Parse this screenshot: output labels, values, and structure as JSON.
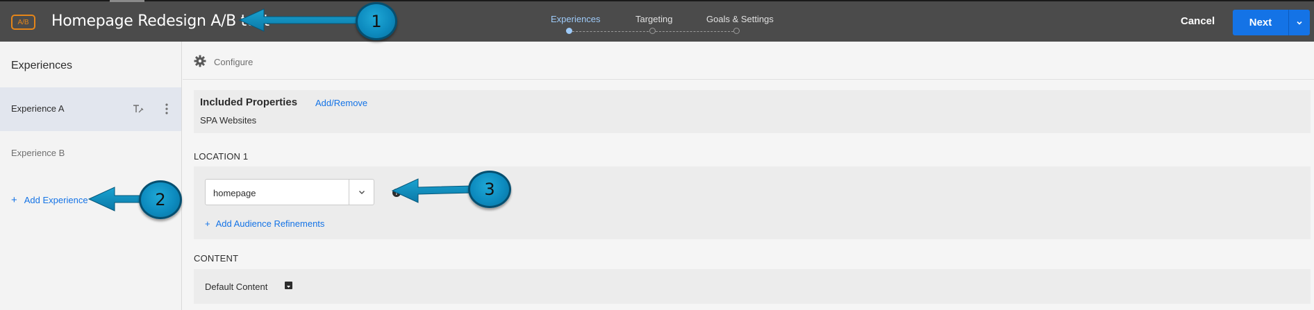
{
  "header": {
    "badge": "A/B",
    "activity_title": "Homepage Redesign A/B test",
    "steps": [
      {
        "label": "Experiences",
        "active": true
      },
      {
        "label": "Targeting",
        "active": false
      },
      {
        "label": "Goals & Settings",
        "active": false
      }
    ],
    "cancel_label": "Cancel",
    "next_label": "Next"
  },
  "sidebar": {
    "title": "Experiences",
    "items": [
      {
        "label": "Experience A",
        "selected": true
      },
      {
        "label": "Experience B",
        "selected": false
      }
    ],
    "add_label": "Add Experience"
  },
  "main": {
    "configure_label": "Configure",
    "included_properties": {
      "title": "Included Properties",
      "link": "Add/Remove",
      "value": "SPA Websites"
    },
    "location": {
      "heading": "LOCATION 1",
      "selected_value": "homepage",
      "refinements_label": "Add Audience Refinements"
    },
    "content": {
      "heading": "CONTENT",
      "label": "Default Content"
    }
  },
  "annotations": [
    {
      "number": "1"
    },
    {
      "number": "2"
    },
    {
      "number": "3"
    }
  ],
  "colors": {
    "topbar": "#4b4b4b",
    "accent_blue": "#1473e6",
    "badge_orange": "#e68619",
    "active_step": "#9ecaf8",
    "callout": "#0d8bbf"
  }
}
